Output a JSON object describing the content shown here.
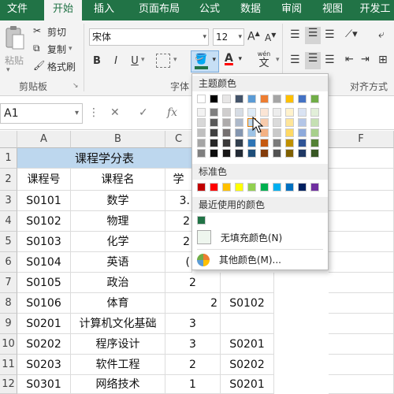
{
  "ribbon_tabs": [
    "文件",
    "开始",
    "插入",
    "页面布局",
    "公式",
    "数据",
    "审阅",
    "视图",
    "开发工"
  ],
  "active_tab": "开始",
  "clipboard": {
    "paste": "粘贴",
    "cut": "剪切",
    "copy": "复制",
    "format_painter": "格式刷",
    "group_label": "剪贴板"
  },
  "font": {
    "name": "宋体",
    "size": "12",
    "bold": "B",
    "italic": "I",
    "underline": "U",
    "group_label": "字体",
    "wen_label": "wén",
    "wen_char": "文"
  },
  "alignment": {
    "group_label": "对齐方式"
  },
  "formula_bar": {
    "name_box": "A1",
    "cancel": "✕",
    "enter": "✓",
    "fx": "fx"
  },
  "columns": [
    "A",
    "B",
    "C",
    "F"
  ],
  "rows": [
    {
      "num": "1",
      "a": "",
      "b": "课程学分表",
      "c": "",
      "d": "",
      "e": ""
    },
    {
      "num": "2",
      "a": "课程号",
      "b": "课程名",
      "c": "学",
      "d": "",
      "e": ""
    },
    {
      "num": "3",
      "a": "S0101",
      "b": "数学",
      "c": "3.",
      "d": "",
      "e": ""
    },
    {
      "num": "4",
      "a": "S0102",
      "b": "物理",
      "c": "2",
      "d": "",
      "e": ""
    },
    {
      "num": "5",
      "a": "S0103",
      "b": "化学",
      "c": "2",
      "d": "",
      "e": ""
    },
    {
      "num": "6",
      "a": "S0104",
      "b": "英语",
      "c": "(",
      "d": "",
      "e": ""
    },
    {
      "num": "7",
      "a": "S0105",
      "b": "政治",
      "c": "2",
      "d": "",
      "e": ""
    },
    {
      "num": "8",
      "a": "S0106",
      "b": "体育",
      "c": "",
      "d": "2",
      "e": "S0102"
    },
    {
      "num": "9",
      "a": "S0201",
      "b": "计算机文化基础",
      "c": "3",
      "d": "",
      "e": ""
    },
    {
      "num": "10",
      "a": "S0202",
      "b": "程序设计",
      "c": "3",
      "d": "",
      "e": "S0201"
    },
    {
      "num": "11",
      "a": "S0203",
      "b": "软件工程",
      "c": "2",
      "d": "",
      "e": "S0202"
    },
    {
      "num": "12",
      "a": "S0301",
      "b": "网络技术",
      "c": "1",
      "d": "",
      "e": "S0201"
    }
  ],
  "color_picker": {
    "theme_label": "主题颜色",
    "standard_label": "标准色",
    "recent_label": "最近使用的颜色",
    "no_fill": "无填充颜色(N)",
    "more_colors": "其他颜色(M)...",
    "theme_top": [
      "#ffffff",
      "#000000",
      "#e7e6e6",
      "#44546a",
      "#5b9bd5",
      "#ed7d31",
      "#a5a5a5",
      "#ffc000",
      "#4472c4",
      "#70ad47"
    ],
    "theme_shades": [
      [
        "#f2f2f2",
        "#7f7f7f",
        "#d0cece",
        "#d6dce4",
        "#deebf6",
        "#fbe5d5",
        "#ededed",
        "#fff2cc",
        "#dae3f3",
        "#e2efd9"
      ],
      [
        "#d8d8d8",
        "#595959",
        "#aeabab",
        "#adb9ca",
        "#bdd7ee",
        "#f7cbac",
        "#dbdbdb",
        "#fee599",
        "#b4c6e7",
        "#c5e0b3"
      ],
      [
        "#bfbfbf",
        "#3f3f3f",
        "#757070",
        "#8496b0",
        "#9dc3e6",
        "#f4b183",
        "#c9c9c9",
        "#ffd965",
        "#8eaadb",
        "#a8d08d"
      ],
      [
        "#a5a5a5",
        "#262626",
        "#3a3838",
        "#323f4f",
        "#2e75b5",
        "#c55a11",
        "#7b7b7b",
        "#bf9000",
        "#2f5496",
        "#538135"
      ],
      [
        "#7f7f7f",
        "#0c0c0c",
        "#171616",
        "#222a35",
        "#1e4e79",
        "#833c0b",
        "#525252",
        "#7f6000",
        "#1f3864",
        "#375623"
      ]
    ],
    "standard": [
      "#c00000",
      "#ff0000",
      "#ffc000",
      "#ffff00",
      "#92d050",
      "#00b050",
      "#00b0f0",
      "#0070c0",
      "#002060",
      "#7030a0"
    ],
    "recent": [
      "#217346"
    ],
    "accent": "#217346",
    "header_fill": "#bdd7ee"
  }
}
